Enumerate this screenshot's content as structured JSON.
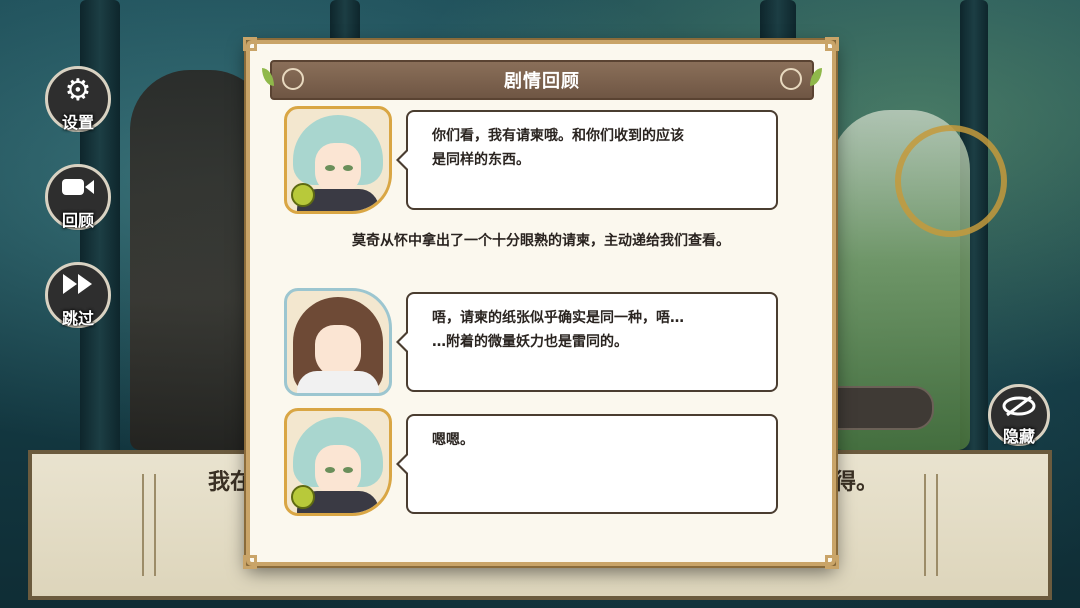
{
  "review_panel": {
    "title": "剧情回顾",
    "entries": [
      {
        "speaker_avatar": "green-hair-boy-avatar",
        "lines": [
          "你们看，我有请柬哦。和你们收到的应该",
          "是同样的东西。"
        ]
      },
      {
        "narration": "莫奇从怀中拿出了一个十分眼熟的请柬，主动递给我们查看。"
      },
      {
        "speaker_avatar": "brown-hair-girl-avatar",
        "lines": [
          "唔，请柬的纸张似乎确实是同一种，唔…",
          "…附着的微量妖力也是雷同的。"
        ]
      },
      {
        "speaker_avatar": "green-hair-boy-avatar",
        "lines": [
          "嗯嗯。"
        ]
      }
    ]
  },
  "side_menu": {
    "settings": {
      "label": "设置",
      "icon": "gear-icon"
    },
    "review": {
      "label": "回顾",
      "icon": "video-camera-icon"
    },
    "skip": {
      "label": "跳过",
      "icon": "fast-forward-icon"
    }
  },
  "hide_button": {
    "label": "隐藏",
    "icon": "eye-slash-icon"
  },
  "dialogue_box": {
    "text_left": "我在",
    "text_right": "的得。"
  },
  "colors": {
    "panel_border": "#c9a468",
    "header_bg": "#7a604c",
    "bubble_border": "#4a3d30",
    "badge_green": "#b8c93a"
  }
}
